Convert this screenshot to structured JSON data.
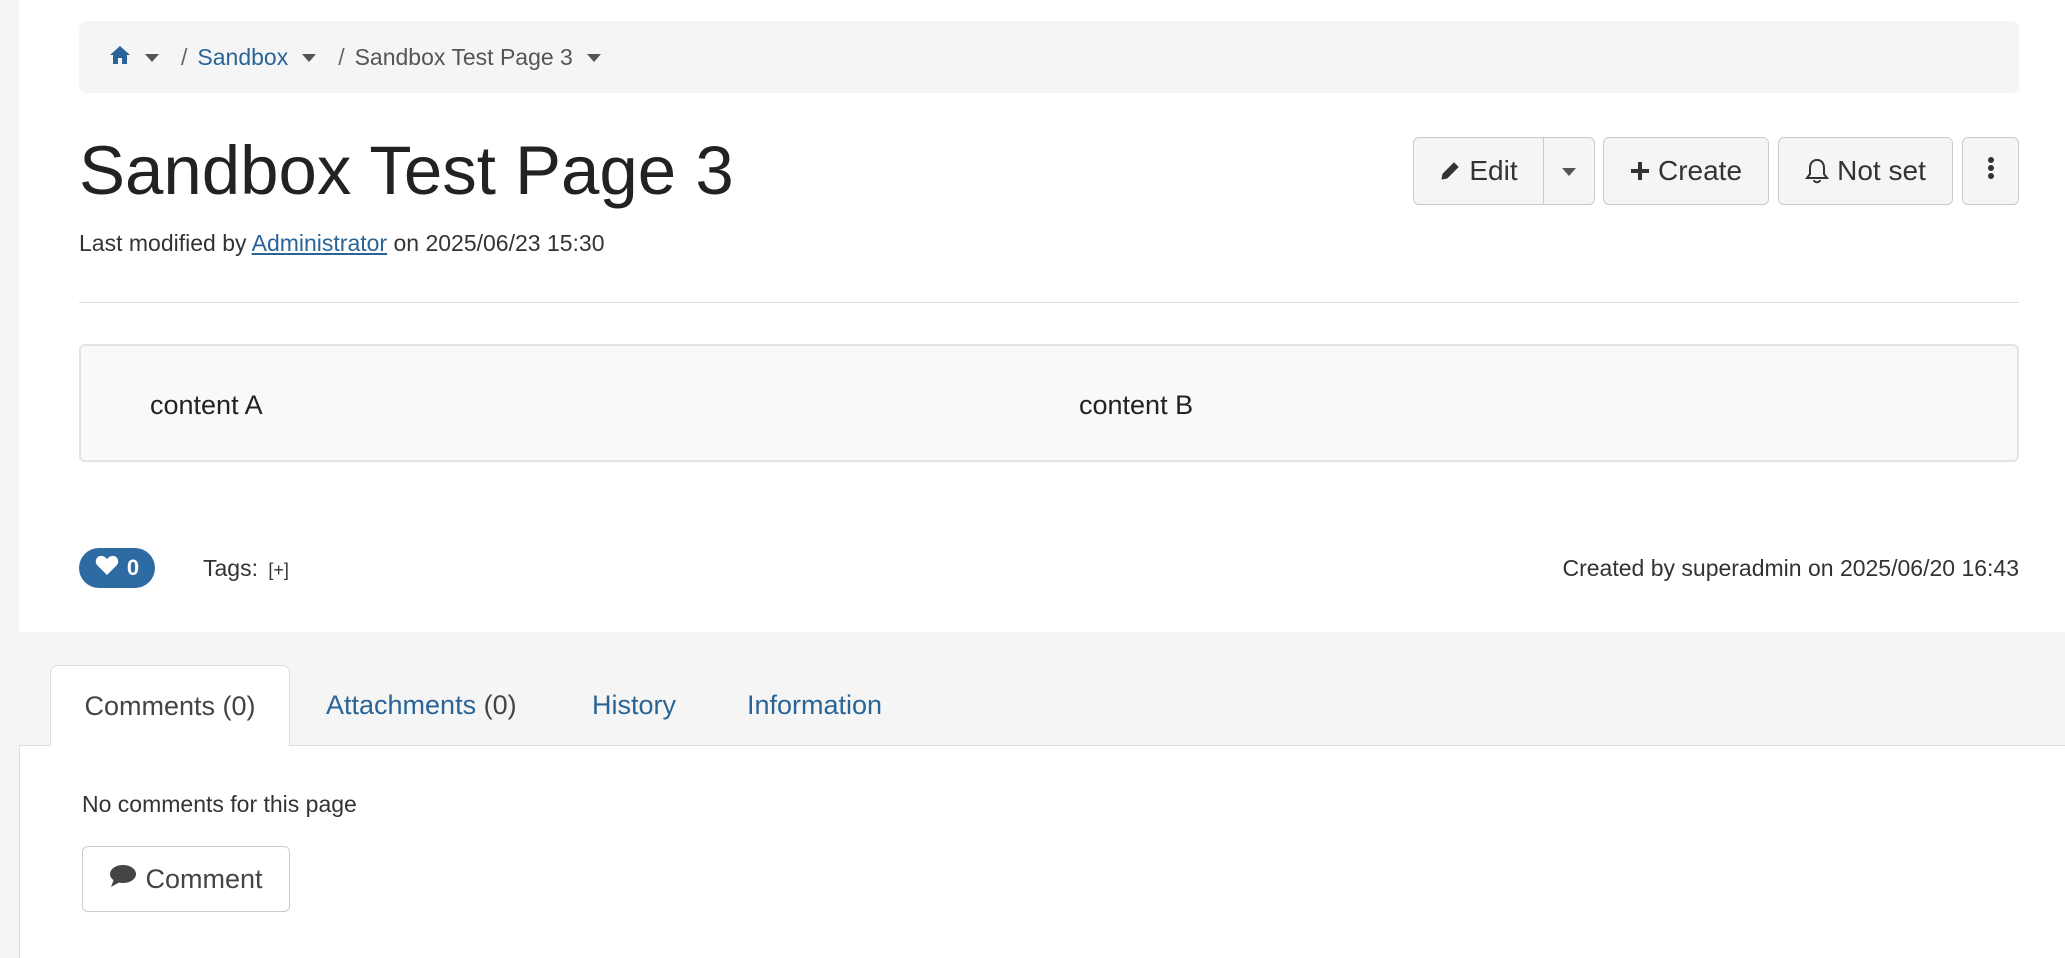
{
  "breadcrumb": {
    "home_icon": "home-icon",
    "items": [
      {
        "label": "Sandbox"
      },
      {
        "label": "Sandbox Test Page 3"
      }
    ],
    "separator": "/"
  },
  "page": {
    "title": "Sandbox Test Page 3",
    "modified_prefix": "Last modified by",
    "modified_user": "Administrator",
    "modified_suffix": "on 2025/06/23 15:30"
  },
  "toolbar": {
    "edit_label": "Edit",
    "create_label": "Create",
    "notify_label": "Not set"
  },
  "content": {
    "col_a": "content A",
    "col_b": "content B"
  },
  "footer": {
    "like_count": "0",
    "tags_label": "Tags:",
    "tags_add": "[+]",
    "created_text": "Created by superadmin on 2025/06/20 16:43"
  },
  "tabs": [
    {
      "label": "Comments",
      "count": "(0)"
    },
    {
      "label": "Attachments",
      "count": "(0)"
    },
    {
      "label": "History"
    },
    {
      "label": "Information"
    }
  ],
  "comments": {
    "empty_text": "No comments for this page",
    "button_label": "Comment"
  },
  "colors": {
    "link": "#2a6496",
    "badge": "#2f6ba3"
  }
}
